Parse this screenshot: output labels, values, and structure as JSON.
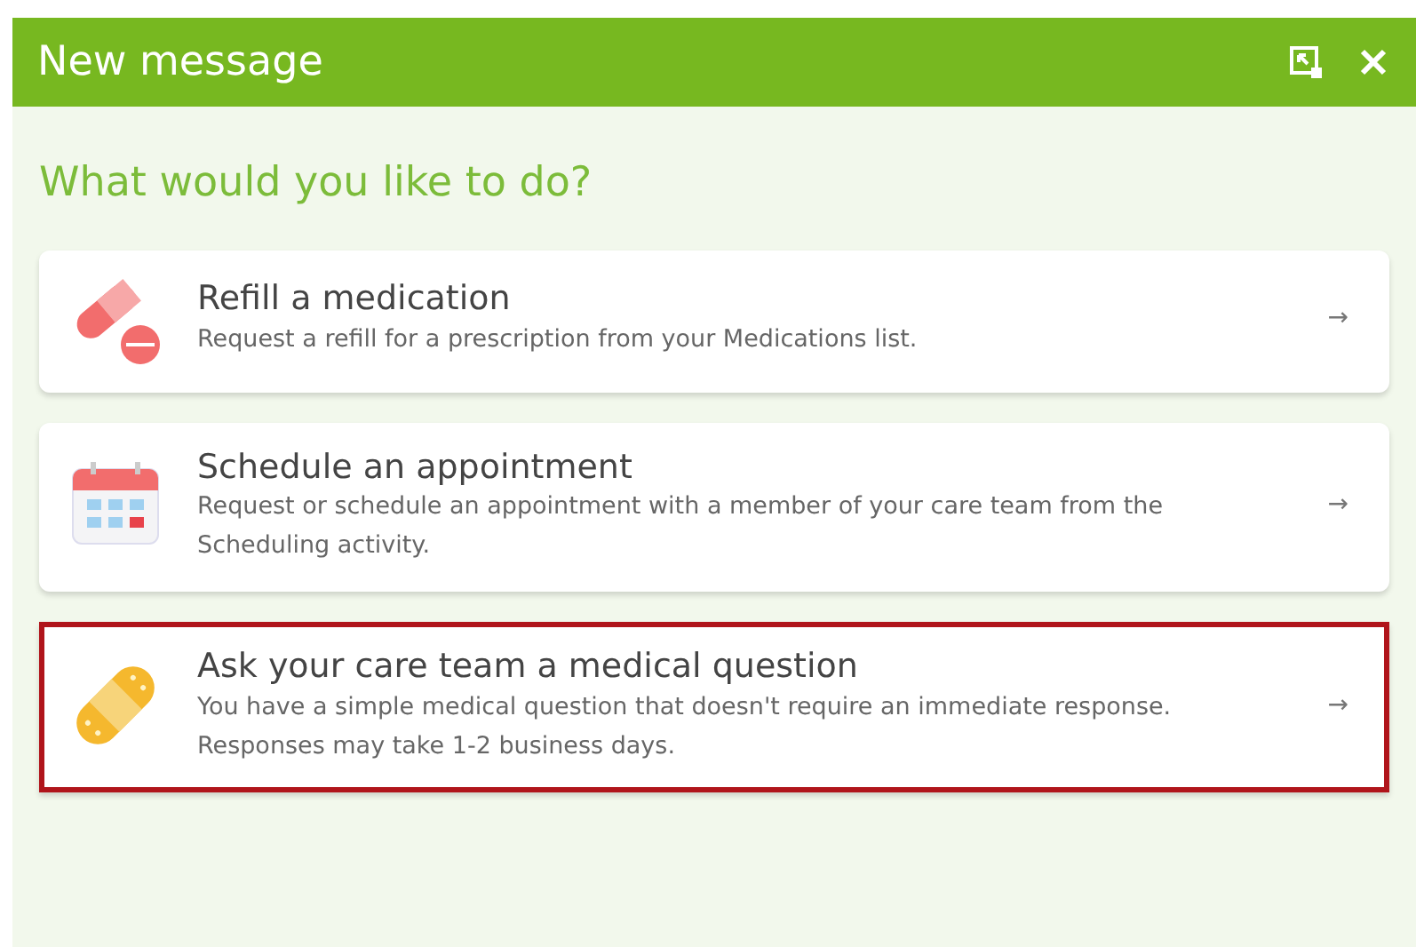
{
  "window": {
    "title": "New message"
  },
  "heading": "What would you like to do?",
  "options": [
    {
      "kind": "pill",
      "title": "Refill a medication",
      "description": "Request a refill for a prescription from your Medications list.",
      "arrow": "→",
      "highlighted": false
    },
    {
      "kind": "calendar",
      "title": "Schedule an appointment",
      "description": "Request or schedule an appointment with a member of your care team from the Scheduling activity.",
      "arrow": "→",
      "highlighted": false
    },
    {
      "kind": "bandage",
      "title": "Ask your care team a medical question",
      "description": "You have a simple medical question that doesn't require an immediate response. Responses may take 1-2 business days.",
      "arrow": "→",
      "highlighted": true
    }
  ]
}
